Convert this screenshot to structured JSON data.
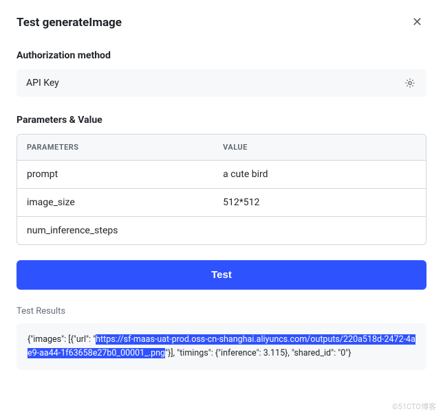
{
  "header": {
    "title": "Test generateImage"
  },
  "auth": {
    "label": "Authorization method",
    "value": "API Key"
  },
  "params": {
    "label": "Parameters & Value",
    "columns": {
      "name": "PARAMETERS",
      "value": "VALUE"
    },
    "rows": [
      {
        "name": "prompt",
        "value": "a cute bird"
      },
      {
        "name": "image_size",
        "value": "512*512"
      },
      {
        "name": "num_inference_steps",
        "value": ""
      }
    ]
  },
  "buttons": {
    "test": "Test"
  },
  "results": {
    "label": "Test Results",
    "pre": "{\"images\": [{\"url\": \"",
    "selected": "https://sf-maas-uat-prod.oss-cn-shanghai.aliyuncs.com/outputs/220a518d-2472-4ae9-aa44-1f63658e27b0_00001_.png",
    "post": "\"}], \"timings\": {\"inference\": 3.115}, \"shared_id\": \"0\"}"
  },
  "watermark": "©51CTO博客"
}
